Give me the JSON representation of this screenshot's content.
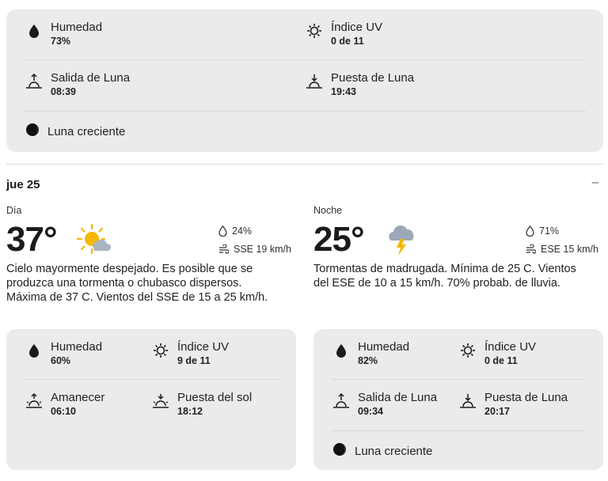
{
  "top_card": {
    "humidity": {
      "label": "Humedad",
      "value": "73%"
    },
    "uv": {
      "label": "Índice UV",
      "value": "0 de 11"
    },
    "moonrise": {
      "label": "Salida de Luna",
      "value": "08:39"
    },
    "moonset": {
      "label": "Puesta de Luna",
      "value": "19:43"
    },
    "moon_phase": "Luna creciente"
  },
  "day": {
    "date": "jue 25",
    "collapse_symbol": "–",
    "day_part": {
      "label": "Día",
      "temp": "37°",
      "icon": "partly-sunny-icon",
      "precip": "24%",
      "wind": "SSE 19 km/h",
      "description": "Cielo mayormente despejado. Es posible que se produzca una tormenta o chubasco dispersos. Máxima de 37 C. Vientos del SSE de 15 a 25 km/h.",
      "details": {
        "humidity": {
          "label": "Humedad",
          "value": "60%"
        },
        "uv": {
          "label": "Índice UV",
          "value": "9 de 11"
        },
        "sunrise": {
          "label": "Amanecer",
          "value": "06:10"
        },
        "sunset": {
          "label": "Puesta del sol",
          "value": "18:12"
        }
      }
    },
    "night_part": {
      "label": "Noche",
      "temp": "25°",
      "icon": "thunderstorm-icon",
      "precip": "71%",
      "wind": "ESE 15 km/h",
      "description": "Tormentas de madrugada. Mínima de 25 C. Vientos del ESE de 10 a 15 km/h. 70% probab. de lluvia.",
      "details": {
        "humidity": {
          "label": "Humedad",
          "value": "82%"
        },
        "uv": {
          "label": "Índice UV",
          "value": "0 de 11"
        },
        "moonrise": {
          "label": "Salida de Luna",
          "value": "09:34"
        },
        "moonset": {
          "label": "Puesta de Luna",
          "value": "20:17"
        },
        "moon_phase": "Luna creciente"
      }
    }
  },
  "colors": {
    "card_bg": "#ebebeb",
    "sun": "#f5b800",
    "cloud": "#9aa8b8",
    "bolt": "#f5b800"
  }
}
